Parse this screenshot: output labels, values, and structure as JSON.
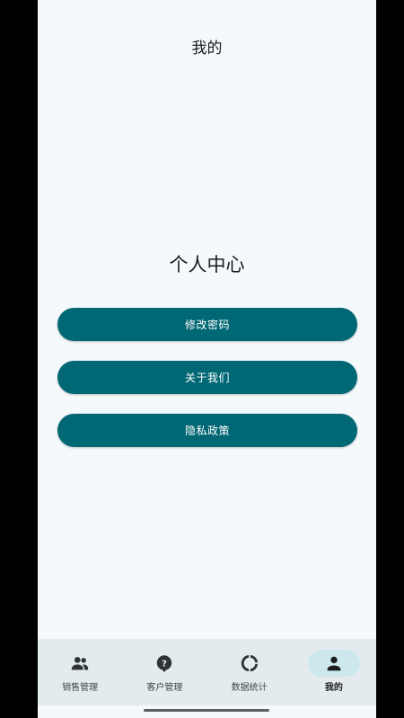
{
  "app_bar": {
    "title": "我的"
  },
  "main": {
    "section_title": "个人中心",
    "buttons": [
      {
        "label": "修改密码"
      },
      {
        "label": "关于我们"
      },
      {
        "label": "隐私政策"
      }
    ]
  },
  "bottom_nav": {
    "items": [
      {
        "label": "销售管理",
        "icon": "people-icon",
        "active": false
      },
      {
        "label": "客户管理",
        "icon": "help-bubble-icon",
        "active": false
      },
      {
        "label": "数据统计",
        "icon": "donut-chart-icon",
        "active": false
      },
      {
        "label": "我的",
        "icon": "person-icon",
        "active": true
      }
    ]
  },
  "colors": {
    "background": "#f4f9fc",
    "primary": "#006774",
    "nav_background": "#e4ebee",
    "nav_active_indicator": "#cce8ec"
  }
}
